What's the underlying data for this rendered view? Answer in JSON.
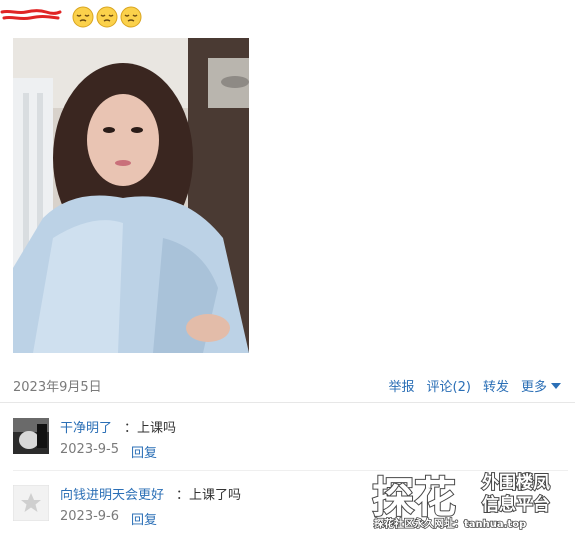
{
  "post": {
    "emojis": [
      "sleepy-face",
      "sleepy-face",
      "sleepy-face"
    ]
  },
  "meta": {
    "date": "2023年9月5日",
    "report": "举报",
    "comment": "评论(2)",
    "forward": "转发",
    "more": "更多"
  },
  "comments": [
    {
      "user": "干净明了",
      "text": "：上课吗",
      "date": "2023-9-5",
      "reply": "回复"
    },
    {
      "user": "向钱进明天会更好",
      "text": "：上课了吗",
      "date": "2023-9-6",
      "reply": "回复"
    }
  ],
  "watermark": {
    "big": "探花",
    "line1": "外围楼凤",
    "line2": "信息平台",
    "footer": "探花社区永久网址：tanhua.top"
  },
  "colors": {
    "link": "#2b6fb6",
    "muted": "#7a7a7a",
    "redaction": "#e02424"
  }
}
